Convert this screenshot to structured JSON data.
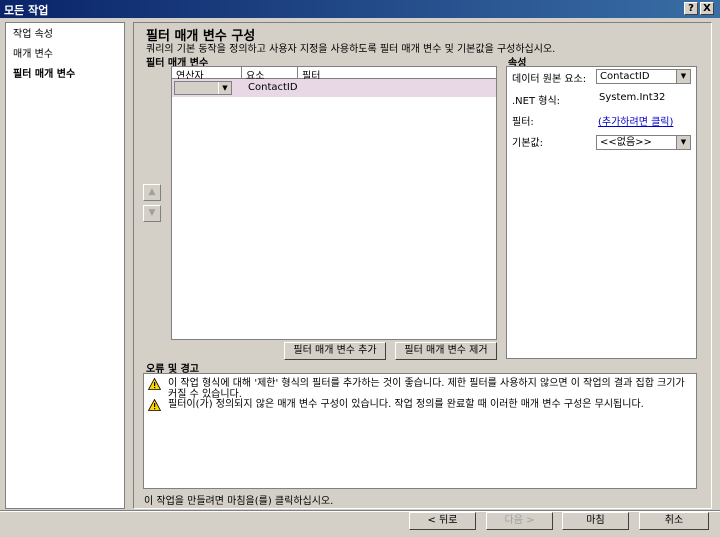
{
  "window": {
    "title": "모든 작업",
    "help_btn": "?",
    "close_btn": "X"
  },
  "nav": {
    "items": [
      {
        "label": "작업 속성"
      },
      {
        "label": "매개 변수"
      },
      {
        "label": "필터 매개 변수"
      }
    ]
  },
  "page": {
    "title": "필터 매개 변수 구성",
    "description": "쿼리의 기본 동작을 정의하고 사용자 지정을 사용하도록 필터 매개 변수 및 기본값을 구성하십시오."
  },
  "filter_params": {
    "label": "필터 매개 변수",
    "columns": [
      "연산자",
      "요소",
      "필터"
    ],
    "rows": [
      {
        "operator": "",
        "element": "ContactID",
        "filter": ""
      }
    ],
    "add_button": "필터 매개 변수 추가",
    "remove_button": "필터 매개 변수 제거"
  },
  "properties": {
    "label": "속성",
    "data_source_label": "데이터 원본 요소:",
    "data_source_value": "ContactID",
    "net_type_label": ".NET 형식:",
    "net_type_value": "System.Int32",
    "filter_label": "필터:",
    "filter_link": "(추가하려면 클릭)",
    "default_label": "기본값:",
    "default_value": "<<없음>>"
  },
  "errors": {
    "label": "오류 및 경고",
    "items": [
      {
        "text": "이 작업 형식에 대해 '제한' 형식의 필터를 추가하는 것이 좋습니다. 제한 필터를 사용하지 않으면 이 작업의 결과 집합 크기가 커질 수 있습니다."
      },
      {
        "text": "필터이(가) 정의되지 않은 매개 변수 구성이 있습니다. 작업 정의를 완료할 때 이러한 매개 변수 구성은 무시됩니다."
      }
    ]
  },
  "footer": {
    "instruction": "이 작업을 만들려면 마침을(를) 클릭하십시오.",
    "back": "< 뒤로",
    "next": "다음 >",
    "finish": "마침",
    "cancel": "취소"
  }
}
